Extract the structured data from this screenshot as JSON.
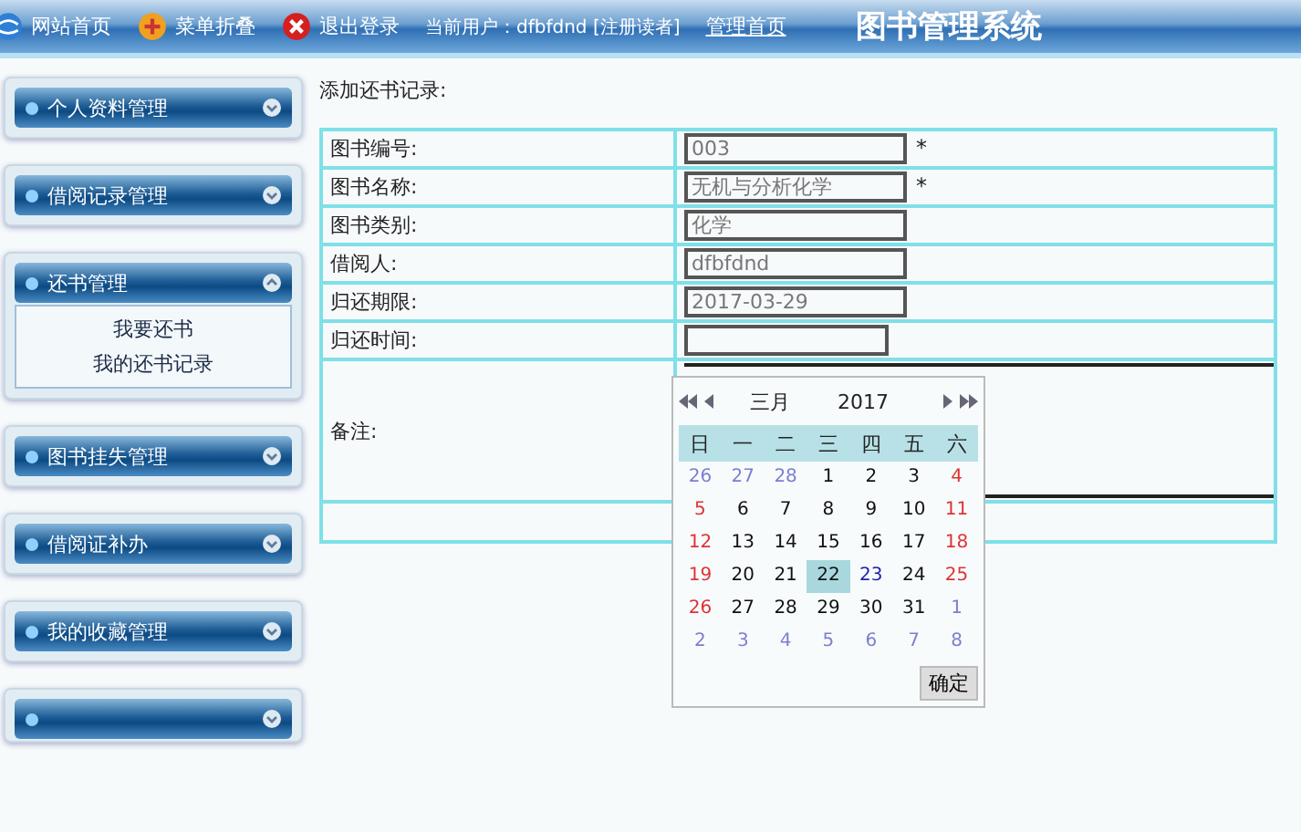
{
  "top_bar": {
    "links": [
      {
        "label": "网站首页"
      },
      {
        "label": "菜单折叠"
      },
      {
        "label": "退出登录"
      }
    ],
    "user_text": "当前用户：dfbfdnd [注册读者]",
    "admin_link": "管理首页",
    "title": "图书管理系统"
  },
  "sidebar": {
    "items": [
      {
        "label": "个人资料管理",
        "expanded": false
      },
      {
        "label": "借阅记录管理",
        "expanded": false
      },
      {
        "label": "还书管理",
        "expanded": true,
        "children": [
          "我要还书",
          "我的还书记录"
        ]
      },
      {
        "label": "图书挂失管理",
        "expanded": false
      },
      {
        "label": "借阅证补办",
        "expanded": false
      },
      {
        "label": "我的收藏管理",
        "expanded": false
      },
      {
        "expanded": false
      }
    ]
  },
  "form": {
    "heading": "添加还书记录:",
    "rows": [
      {
        "kind": "field",
        "label": "图书编号:",
        "value": "003",
        "required_mark": "*"
      },
      {
        "kind": "field",
        "label": "图书名称:",
        "value": "无机与分析化学",
        "required_mark": "*"
      },
      {
        "kind": "field",
        "label": "图书类别:",
        "value": "化学"
      },
      {
        "kind": "field",
        "label": "借阅人:",
        "value": "dfbfdnd"
      },
      {
        "kind": "field",
        "label": "归还期限:",
        "value": "2017-03-29"
      },
      {
        "kind": "date",
        "label": "归还时间:"
      },
      {
        "kind": "textarea",
        "label": "备注:"
      },
      {
        "kind": "empty"
      }
    ]
  },
  "calendar": {
    "month": "三月",
    "year": "2017",
    "weekdays": [
      "日",
      "一",
      "二",
      "三",
      "四",
      "五",
      "六"
    ],
    "days": [
      {
        "day": "26",
        "kind": "other",
        "selected": false,
        "today": false
      },
      {
        "day": "27",
        "kind": "other",
        "selected": false,
        "today": false
      },
      {
        "day": "28",
        "kind": "other",
        "selected": false,
        "today": false
      },
      {
        "day": "1",
        "kind": "current",
        "selected": false,
        "today": false
      },
      {
        "day": "2",
        "kind": "current",
        "selected": false,
        "today": false
      },
      {
        "day": "3",
        "kind": "current",
        "selected": false,
        "today": false
      },
      {
        "day": "4",
        "kind": "current",
        "selected": false,
        "today": false
      },
      {
        "day": "5",
        "kind": "current",
        "selected": false,
        "today": false
      },
      {
        "day": "6",
        "kind": "current",
        "selected": false,
        "today": false
      },
      {
        "day": "7",
        "kind": "current",
        "selected": false,
        "today": false
      },
      {
        "day": "8",
        "kind": "current",
        "selected": false,
        "today": false
      },
      {
        "day": "9",
        "kind": "current",
        "selected": false,
        "today": false
      },
      {
        "day": "10",
        "kind": "current",
        "selected": false,
        "today": false
      },
      {
        "day": "11",
        "kind": "current",
        "selected": false,
        "today": false
      },
      {
        "day": "12",
        "kind": "current",
        "selected": false,
        "today": false
      },
      {
        "day": "13",
        "kind": "current",
        "selected": false,
        "today": false
      },
      {
        "day": "14",
        "kind": "current",
        "selected": false,
        "today": false
      },
      {
        "day": "15",
        "kind": "current",
        "selected": false,
        "today": false
      },
      {
        "day": "16",
        "kind": "current",
        "selected": false,
        "today": false
      },
      {
        "day": "17",
        "kind": "current",
        "selected": false,
        "today": false
      },
      {
        "day": "18",
        "kind": "current",
        "selected": false,
        "today": false
      },
      {
        "day": "19",
        "kind": "current",
        "selected": false,
        "today": false
      },
      {
        "day": "20",
        "kind": "current",
        "selected": false,
        "today": false
      },
      {
        "day": "21",
        "kind": "current",
        "selected": false,
        "today": false
      },
      {
        "day": "22",
        "kind": "current",
        "selected": true,
        "today": false
      },
      {
        "day": "23",
        "kind": "current",
        "selected": false,
        "today": true
      },
      {
        "day": "24",
        "kind": "current",
        "selected": false,
        "today": false
      },
      {
        "day": "25",
        "kind": "current",
        "selected": false,
        "today": false
      },
      {
        "day": "26",
        "kind": "current",
        "selected": false,
        "today": false
      },
      {
        "day": "27",
        "kind": "current",
        "selected": false,
        "today": false
      },
      {
        "day": "28",
        "kind": "current",
        "selected": false,
        "today": false
      },
      {
        "day": "29",
        "kind": "current",
        "selected": false,
        "today": false
      },
      {
        "day": "30",
        "kind": "current",
        "selected": false,
        "today": false
      },
      {
        "day": "31",
        "kind": "current",
        "selected": false,
        "today": false
      },
      {
        "day": "1",
        "kind": "other",
        "selected": false,
        "today": false
      },
      {
        "day": "2",
        "kind": "other",
        "selected": false,
        "today": false
      },
      {
        "day": "3",
        "kind": "other",
        "selected": false,
        "today": false
      },
      {
        "day": "4",
        "kind": "other",
        "selected": false,
        "today": false
      },
      {
        "day": "5",
        "kind": "other",
        "selected": false,
        "today": false
      },
      {
        "day": "6",
        "kind": "other",
        "selected": false,
        "today": false
      },
      {
        "day": "7",
        "kind": "other",
        "selected": false,
        "today": false
      },
      {
        "day": "8",
        "kind": "other",
        "selected": false,
        "today": false
      }
    ],
    "ok_button": "确定"
  }
}
